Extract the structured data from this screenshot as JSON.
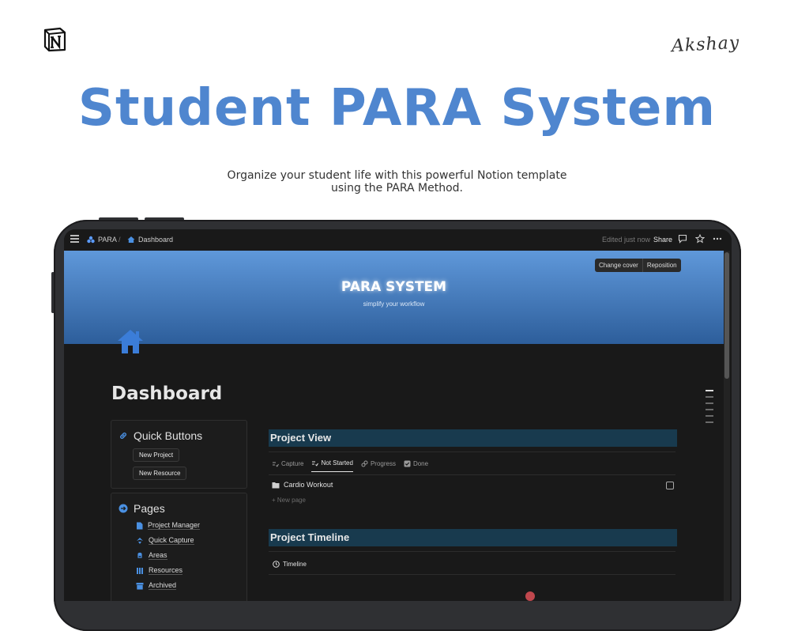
{
  "header": {
    "signature": "Akshay",
    "title": "Student PARA System",
    "subtitle_lines": [
      "Organize your student life with this powerful Notion template",
      "using the PARA Method."
    ]
  },
  "topbar": {
    "breadcrumb_root": "PARA",
    "breadcrumb_sep": "/",
    "breadcrumb_page": "Dashboard",
    "edited": "Edited just now",
    "share": "Share"
  },
  "cover": {
    "change_cover": "Change cover",
    "reposition": "Reposition",
    "title": "PARA SYSTEM",
    "subtitle": "simplify your workflow"
  },
  "page": {
    "title": "Dashboard"
  },
  "quick_buttons": {
    "heading": "Quick Buttons",
    "buttons": [
      "New Project",
      "New Resource"
    ]
  },
  "pages": {
    "heading": "Pages",
    "items": [
      "Project Manager",
      "Quick Capture",
      "Areas",
      "Resources",
      "Archived"
    ]
  },
  "project_view": {
    "heading": "Project View",
    "tabs": [
      "Capture",
      "Not Started",
      "Progress",
      "Done"
    ],
    "rows": [
      "Cardio Workout"
    ],
    "new_page": "New page"
  },
  "project_timeline": {
    "heading": "Project Timeline",
    "tab": "Timeline"
  },
  "colors": {
    "accent": "#4f86cf",
    "section_head_bg": "#183a4e",
    "app_bg": "#191919"
  }
}
